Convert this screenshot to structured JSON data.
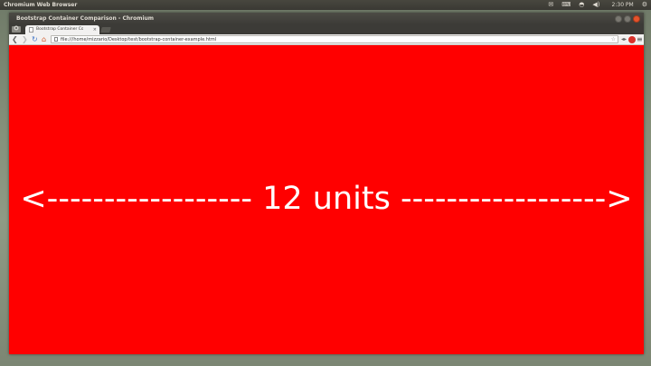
{
  "panel": {
    "app_name": "Chromium Web Browser",
    "clock": "2:30 PM"
  },
  "window": {
    "title": "Bootstrap Container Comparison - Chromium"
  },
  "tab": {
    "label": "Bootstrap Container Com",
    "close": "×"
  },
  "toolbar": {
    "url": "file:///home/mizzario/Desktop/test/bootstrap-container-example.html"
  },
  "content": {
    "text": "<------------------ 12 units ------------------>",
    "background": "#ff0000",
    "text_color": "#ffffff"
  },
  "icons": {
    "tray": [
      "mail-icon",
      "keyboard-icon",
      "network-icon",
      "volume-icon",
      "clock",
      "gear-icon"
    ],
    "nav": [
      "back-icon",
      "forward-icon",
      "reload-icon",
      "home-icon"
    ]
  }
}
